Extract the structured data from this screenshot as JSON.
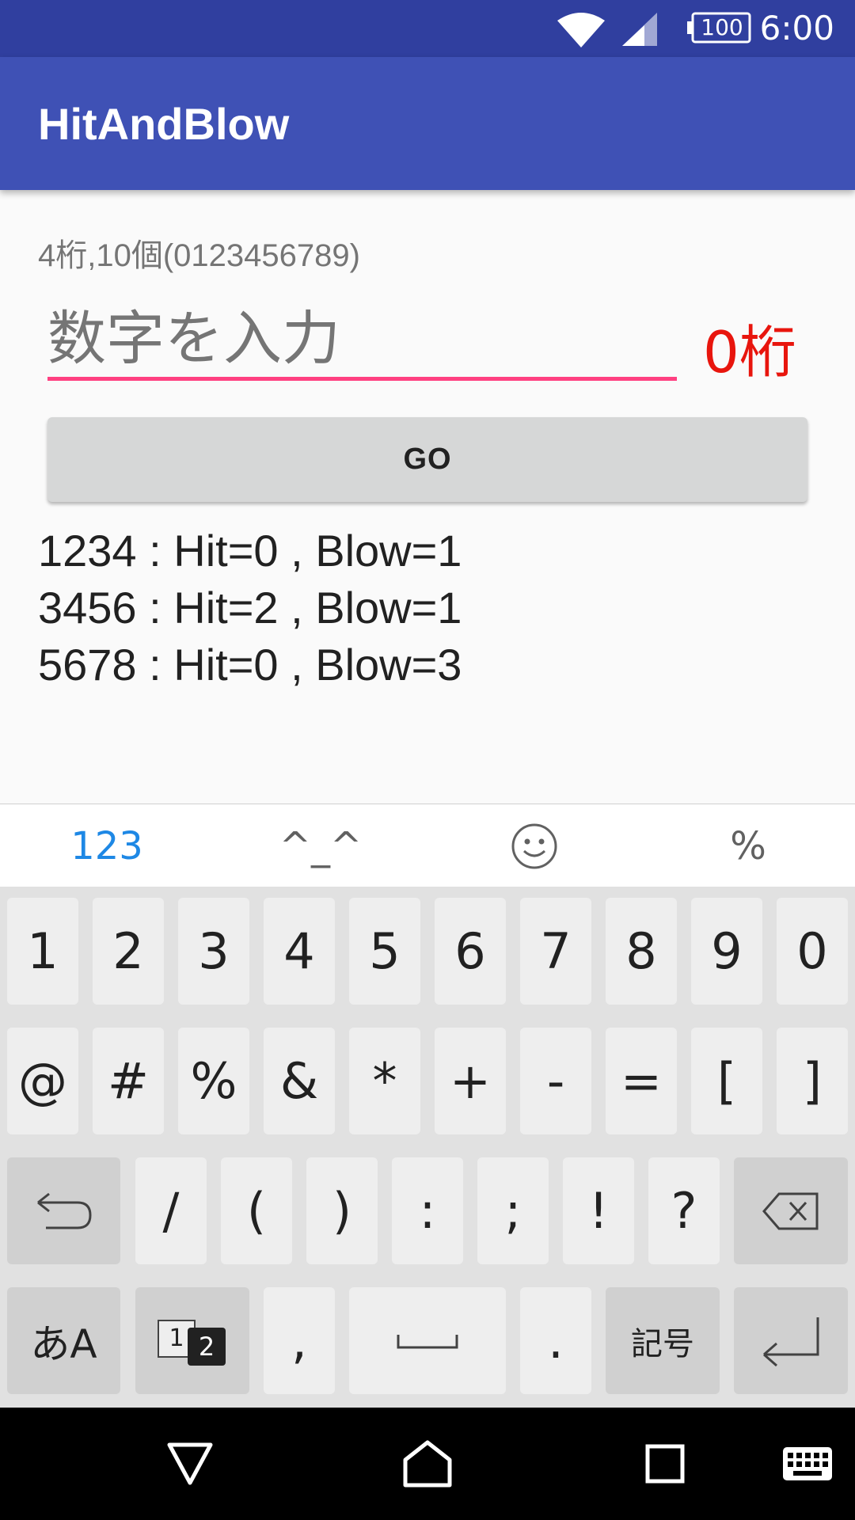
{
  "status_bar": {
    "time": "6:00",
    "battery": "100",
    "wifi_icon": "wifi-icon",
    "signal_icon": "signal-icon"
  },
  "app_bar": {
    "title": "HitAndBlow"
  },
  "form": {
    "info": "4桁,10個(0123456789)",
    "input_value": "",
    "input_placeholder": "数字を入力",
    "digit_count": "0桁",
    "go_label": "GO"
  },
  "history": [
    "1234 : Hit=0 , Blow=1",
    "3456 : Hit=2 , Blow=1",
    "5678 : Hit=0 , Blow=3"
  ],
  "keyboard": {
    "tabs": {
      "numbers": "123",
      "kaomoji": "^_^",
      "emoji": "smiley-icon",
      "symbols": "%"
    },
    "row1": [
      "1",
      "2",
      "3",
      "4",
      "5",
      "6",
      "7",
      "8",
      "9",
      "0"
    ],
    "row2": [
      "@",
      "#",
      "%",
      "&",
      "*",
      "+",
      "-",
      "=",
      "[",
      "]"
    ],
    "row3": [
      "/",
      "(",
      ")",
      ":",
      ";",
      "!",
      "?"
    ],
    "row4": {
      "mode": "あA",
      "comma": ",",
      "period": ".",
      "symbols": "記号",
      "toggle_top": "1",
      "toggle_bottom": "2"
    }
  },
  "colors": {
    "status_bar": "#303f9f",
    "app_bar": "#3f51b5",
    "accent": "#ff4081",
    "digit_count": "#e8150d",
    "tab_active": "#1e88e5"
  }
}
